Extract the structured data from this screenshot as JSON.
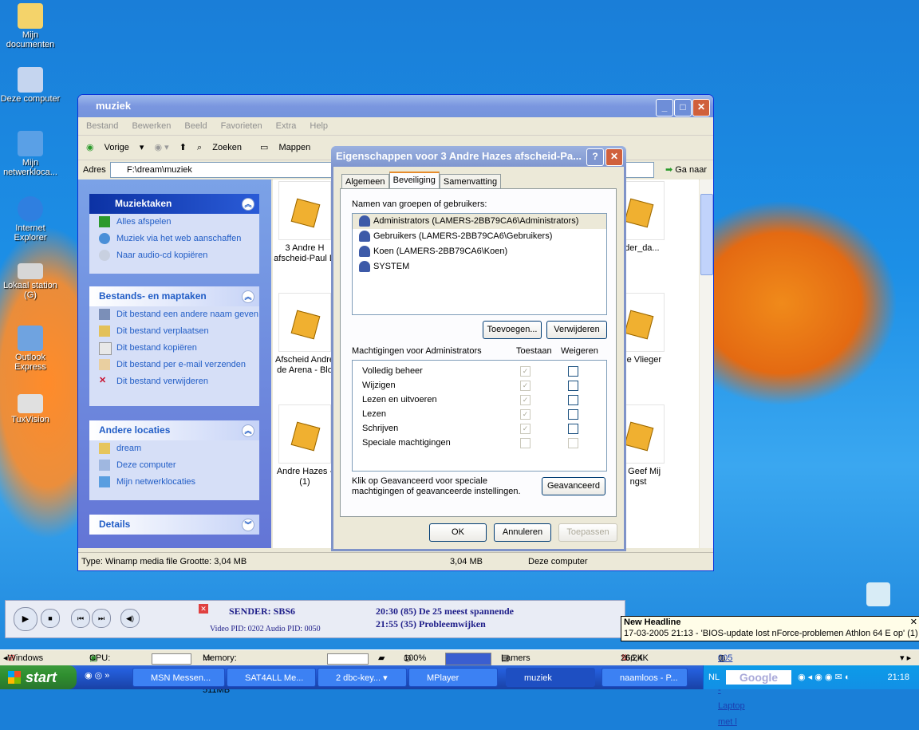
{
  "desktop_icons": [
    {
      "label": "Mijn documenten",
      "icon": "folder-documents-icon"
    },
    {
      "label": "Deze computer",
      "icon": "computer-icon"
    },
    {
      "label": "Mijn netwerkloca...",
      "icon": "network-icon"
    },
    {
      "label": "Internet Explorer",
      "icon": "ie-icon"
    },
    {
      "label": "Lokaal station (G)",
      "icon": "drive-icon"
    },
    {
      "label": "Outlook Express",
      "icon": "outlook-icon"
    },
    {
      "label": "TuxVision",
      "icon": "tuxvision-icon"
    }
  ],
  "explorer": {
    "title": "muziek",
    "menu": [
      "Bestand",
      "Bewerken",
      "Beeld",
      "Favorieten",
      "Extra",
      "Help"
    ],
    "toolbar": {
      "back": "Vorige",
      "search": "Zoeken",
      "folders": "Mappen"
    },
    "address_label": "Adres",
    "address_value": "F:\\dream\\muziek",
    "goto": "Ga naar",
    "tasks": {
      "music_title": "Muziektaken",
      "music_items": [
        "Alles afspelen",
        "Muziek via het web aanschaffen",
        "Naar audio-cd kopiëren"
      ],
      "file_title": "Bestands- en maptaken",
      "file_items": [
        "Dit bestand een andere naam geven",
        "Dit bestand verplaatsen",
        "Dit bestand kopiëren",
        "Dit bestand per e-mail verzenden",
        "Dit bestand verwijderen"
      ],
      "other_title": "Andere locaties",
      "other_items": [
        "dream",
        "Deze computer",
        "Mijn netwerklocaties"
      ],
      "details_title": "Details"
    },
    "files": [
      {
        "label": "3 Andre H afscheid-Paul D"
      },
      {
        "label": "arder_da..."
      },
      {
        "label": "Afscheid Andre de Arena - Blo"
      },
      {
        "label": "- De Vlieger"
      },
      {
        "label": "Andre Hazes - (1)"
      },
      {
        "label": "s - Geef Mij ngst"
      }
    ],
    "status": {
      "type": "Type: Winamp media file Grootte: 3,04 MB",
      "size": "3,04 MB",
      "location": "Deze computer"
    }
  },
  "dialog": {
    "title": "Eigenschappen voor 3 Andre Hazes afscheid-Pa...",
    "tabs": [
      "Algemeen",
      "Beveiliging",
      "Samenvatting"
    ],
    "groups_label": "Namen van groepen of gebruikers:",
    "users": [
      "Administrators (LAMERS-2BB79CA6\\Administrators)",
      "Gebruikers (LAMERS-2BB79CA6\\Gebruikers)",
      "Koen (LAMERS-2BB79CA6\\Koen)",
      "SYSTEM"
    ],
    "add": "Toevoegen...",
    "remove": "Verwijderen",
    "perm_label": "Machtigingen voor Administrators",
    "allow": "Toestaan",
    "deny": "Weigeren",
    "permissions": [
      {
        "name": "Volledig beheer",
        "allow": true,
        "deny": false
      },
      {
        "name": "Wijzigen",
        "allow": true,
        "deny": false
      },
      {
        "name": "Lezen en uitvoeren",
        "allow": true,
        "deny": false
      },
      {
        "name": "Lezen",
        "allow": true,
        "deny": false
      },
      {
        "name": "Schrijven",
        "allow": true,
        "deny": false
      },
      {
        "name": "Speciale machtigingen",
        "allow": false,
        "deny": false
      }
    ],
    "advanced_text": "Klik op Geavanceerd voor speciale machtigingen of geavanceerde instellingen.",
    "advanced": "Geavanceerd",
    "ok": "OK",
    "cancel": "Annuleren",
    "apply": "Toepassen"
  },
  "mediaplayer": {
    "sender": "SENDER: SBS6",
    "pids": "Video PID: 0202  Audio PID: 0050",
    "epg1": "20:30 (85) De 25 meest spannende",
    "epg2": "21:55 (35) Probleemwijken"
  },
  "news": {
    "title": "New Headline",
    "text": "17-03-2005 21:13 - 'BIOS-update lost nForce-problemen Athlon 64 E op' (1)"
  },
  "statusbar2": {
    "os": "Windows XP",
    "cpu": "CPU: 11%",
    "memory": "Memory: 229MB / 511MB",
    "zoom": "100%",
    "net": "Lamers [192.168.1.101]",
    "traffic": "266,4K",
    "traffic2": "6,2K",
    "ticker": "005 20:15 - Laptop met l"
  },
  "taskbar": {
    "start": "start",
    "items": [
      "MSN Messen...",
      "SAT4ALL Me...",
      "2 dbc-key...",
      "MPlayer",
      "muziek",
      "naamloos - P..."
    ],
    "lang": "NL",
    "search_logo": "Google",
    "time": "21:18"
  }
}
